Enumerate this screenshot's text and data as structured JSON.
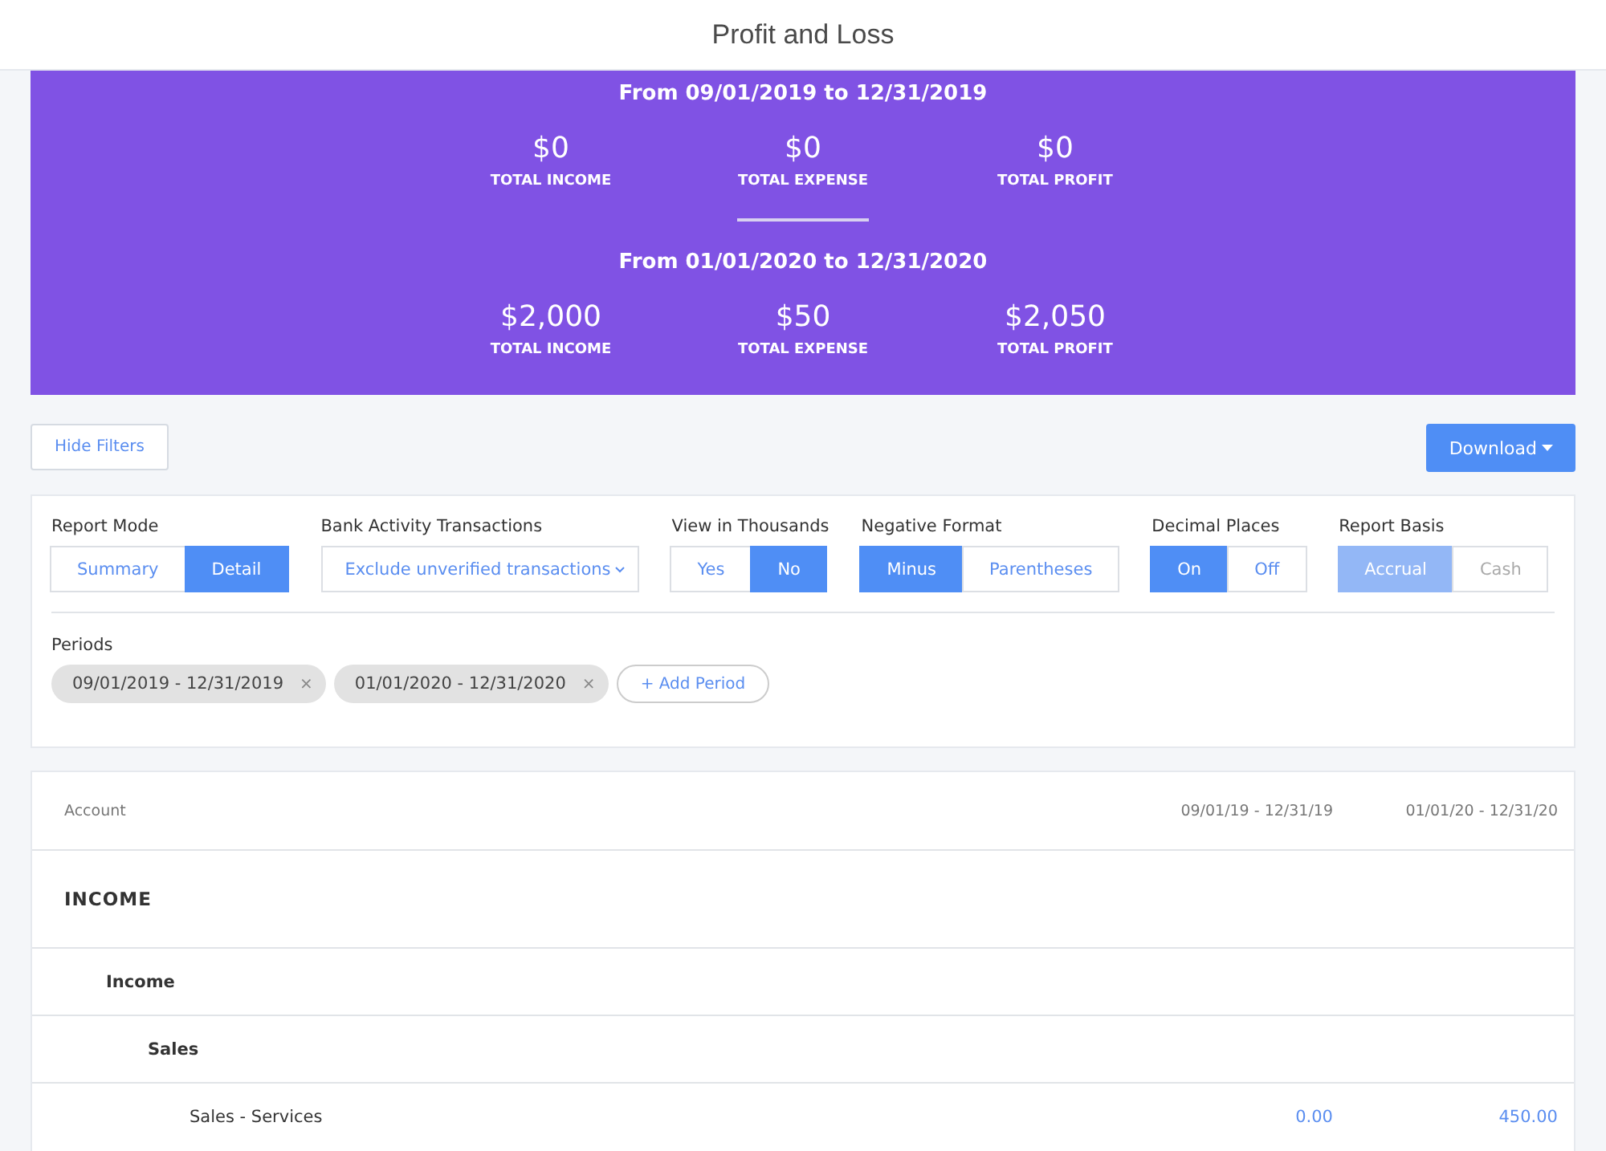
{
  "header": {
    "title": "Profit and Loss"
  },
  "summary": [
    {
      "title": "From 09/01/2019 to 12/31/2019",
      "stats": [
        {
          "value": "$0",
          "label": "TOTAL INCOME"
        },
        {
          "value": "$0",
          "label": "TOTAL EXPENSE"
        },
        {
          "value": "$0",
          "label": "TOTAL PROFIT"
        }
      ]
    },
    {
      "title": "From 01/01/2020 to 12/31/2020",
      "stats": [
        {
          "value": "$2,000",
          "label": "TOTAL INCOME"
        },
        {
          "value": "$50",
          "label": "TOTAL EXPENSE"
        },
        {
          "value": "$2,050",
          "label": "TOTAL PROFIT"
        }
      ]
    }
  ],
  "toolbar": {
    "hide_filters": "Hide Filters",
    "download": "Download"
  },
  "filters": [
    {
      "kind": "segmented",
      "label": "Report Mode",
      "disabled": false,
      "options": [
        {
          "label": "Summary",
          "selected": false
        },
        {
          "label": "Detail",
          "selected": true
        }
      ]
    },
    {
      "kind": "dropdown",
      "label": "Bank Activity Transactions",
      "value": "Exclude unverified transactions"
    },
    {
      "kind": "segmented",
      "label": "View in Thousands",
      "disabled": false,
      "options": [
        {
          "label": "Yes",
          "selected": false
        },
        {
          "label": "No",
          "selected": true
        }
      ]
    },
    {
      "kind": "segmented",
      "label": "Negative Format",
      "disabled": false,
      "options": [
        {
          "label": "Minus",
          "selected": true
        },
        {
          "label": "Parentheses",
          "selected": false
        }
      ]
    },
    {
      "kind": "segmented",
      "label": "Decimal Places",
      "disabled": false,
      "options": [
        {
          "label": "On",
          "selected": true
        },
        {
          "label": "Off",
          "selected": false
        }
      ]
    },
    {
      "kind": "segmented",
      "label": "Report Basis",
      "disabled": true,
      "options": [
        {
          "label": "Accrual",
          "selected": true
        },
        {
          "label": "Cash",
          "selected": false
        }
      ]
    }
  ],
  "periods": {
    "label": "Periods",
    "items": [
      {
        "range": "09/01/2019 - 12/31/2019",
        "remove": "×"
      },
      {
        "range": "01/01/2020 - 12/31/2020",
        "remove": "×"
      }
    ],
    "add": "+ Add Period"
  },
  "table": {
    "columns": [
      "Account",
      "09/01/19 - 12/31/19",
      "01/01/20 - 12/31/20"
    ],
    "rows": [
      {
        "name": "INCOME",
        "children": [
          {
            "name": "Income",
            "children": [
              {
                "name": "Sales",
                "children": [
                  {
                    "name": "Sales - Services",
                    "values": [
                      "0.00",
                      "450.00"
                    ]
                  }
                ]
              }
            ]
          }
        ]
      }
    ]
  }
}
